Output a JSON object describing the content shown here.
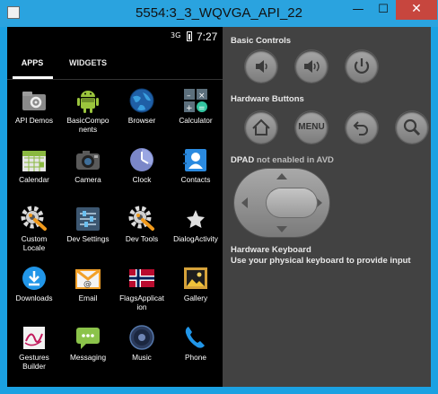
{
  "window": {
    "title": "5554:3_3_WQVGA_API_22",
    "minimize_glyph": "—",
    "maximize_glyph": "☐",
    "close_glyph": "✕"
  },
  "status_bar": {
    "signal": "3G",
    "time": "7:27"
  },
  "tabs": {
    "apps": "APPS",
    "widgets": "WIDGETS",
    "active": "apps"
  },
  "apps": [
    {
      "label": "API Demos",
      "icon": "folder-gear-icon"
    },
    {
      "label": "BasicCompo\nnents",
      "icon": "android-icon"
    },
    {
      "label": "Browser",
      "icon": "globe-icon"
    },
    {
      "label": "Calculator",
      "icon": "calculator-icon"
    },
    {
      "label": "Calendar",
      "icon": "calendar-icon"
    },
    {
      "label": "Camera",
      "icon": "camera-icon"
    },
    {
      "label": "Clock",
      "icon": "clock-icon"
    },
    {
      "label": "Contacts",
      "icon": "contacts-icon"
    },
    {
      "label": "Custom\nLocale",
      "icon": "gear-icon"
    },
    {
      "label": "Dev Settings",
      "icon": "sliders-icon"
    },
    {
      "label": "Dev Tools",
      "icon": "gear-icon"
    },
    {
      "label": "DialogActivity",
      "icon": "star-icon"
    },
    {
      "label": "Downloads",
      "icon": "download-icon"
    },
    {
      "label": "Email",
      "icon": "email-icon"
    },
    {
      "label": "FlagsApplicat\nion",
      "icon": "norway-flag-icon"
    },
    {
      "label": "Gallery",
      "icon": "picture-icon"
    },
    {
      "label": "Gestures\nBuilder",
      "icon": "gesture-icon"
    },
    {
      "label": "Messaging",
      "icon": "message-icon"
    },
    {
      "label": "Music",
      "icon": "speaker-icon"
    },
    {
      "label": "Phone",
      "icon": "phone-icon"
    }
  ],
  "panel": {
    "basic_controls": "Basic Controls",
    "hardware_buttons": "Hardware Buttons",
    "dpad": "DPAD",
    "dpad_note": "not enabled in AVD",
    "keyboard_title": "Hardware Keyboard",
    "keyboard_note": "Use your physical keyboard to provide input",
    "menu_label": "MENU"
  },
  "colors": {
    "titlebar": "#2aa3df",
    "panel": "#424242",
    "close": "#c7463e"
  }
}
